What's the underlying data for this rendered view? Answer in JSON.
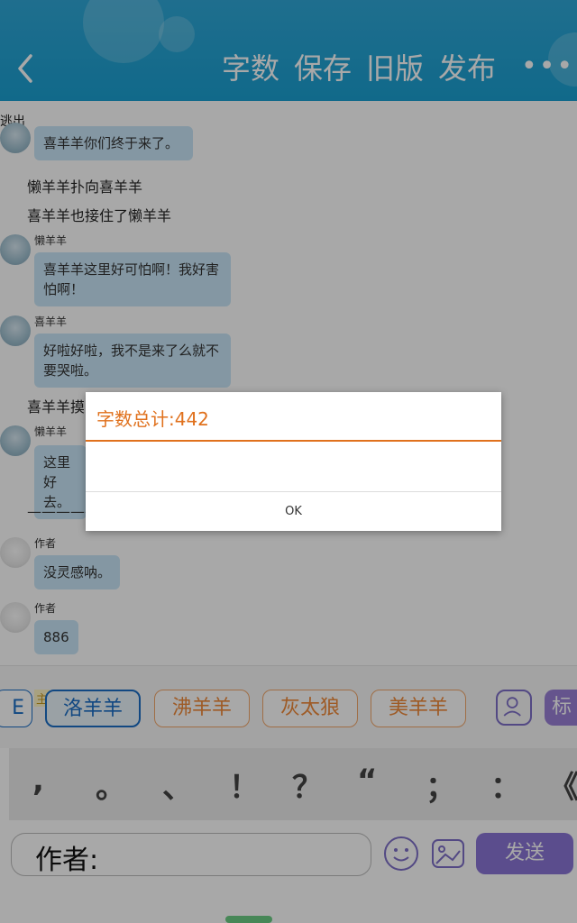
{
  "header": {
    "buttons": [
      "字数",
      "保存",
      "旧版",
      "发布"
    ],
    "more": "•••"
  },
  "chat": {
    "exit_label": "逃出",
    "messages": [
      {
        "type": "bubble",
        "sender": "",
        "text": "喜羊羊你们终于来了。"
      },
      {
        "type": "narration",
        "text": "懒羊羊扑向喜羊羊"
      },
      {
        "type": "narration",
        "text": "喜羊羊也接住了懒羊羊"
      },
      {
        "type": "bubble",
        "sender": "懒羊羊",
        "text": "喜羊羊这里好可怕啊！我好害怕啊！"
      },
      {
        "type": "bubble",
        "sender": "喜羊羊",
        "text": "好啦好啦，我不是来了么就不要哭啦。"
      },
      {
        "type": "narration",
        "text": "喜羊羊摸"
      },
      {
        "type": "bubble",
        "sender": "懒羊羊",
        "text": "这里好去。"
      },
      {
        "type": "divider",
        "text": "——————"
      },
      {
        "type": "bubble",
        "sender": "作者",
        "text": "没灵感呐。"
      },
      {
        "type": "bubble",
        "sender": "作者",
        "text": "886"
      }
    ]
  },
  "dialog": {
    "title": "字数总计:442",
    "ok": "OK"
  },
  "characters": {
    "partial": "E",
    "badge": "主",
    "chips": [
      "洛羊羊",
      "沸羊羊",
      "灰太狼",
      "美羊羊"
    ],
    "tag_label": "标"
  },
  "punctuation": [
    ",",
    "。",
    "、",
    "！",
    "？",
    "“",
    "；",
    "：",
    "《"
  ],
  "input": {
    "prefix": "作者:",
    "send_label": "发送"
  },
  "colors": {
    "header": "#1aa0d2",
    "accent": "#e0711d",
    "bubble": "#c8e6f7",
    "send": "#8b76d6"
  }
}
